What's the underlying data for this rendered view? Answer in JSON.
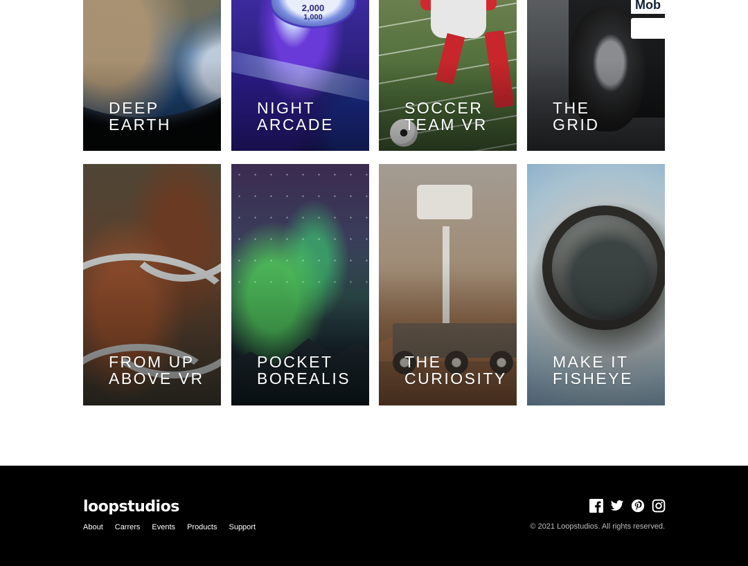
{
  "cards": [
    {
      "title_line1": "DEEP",
      "title_line2": "EARTH"
    },
    {
      "title_line1": "NIGHT",
      "title_line2": "ARCADE"
    },
    {
      "title_line1": "SOCCER",
      "title_line2": "TEAM VR"
    },
    {
      "title_line1": "THE",
      "title_line2": "GRID"
    },
    {
      "title_line1": "FROM UP",
      "title_line2": "ABOVE VR"
    },
    {
      "title_line1": "POCKET",
      "title_line2": "BOREALIS"
    },
    {
      "title_line1": "THE",
      "title_line2": "CURIOSITY"
    },
    {
      "title_line1": "MAKE IT",
      "title_line2": "FISHEYE"
    }
  ],
  "footer": {
    "logo": "loopstudios",
    "nav": [
      "About",
      "Carrers",
      "Events",
      "Products",
      "Support"
    ],
    "social": [
      "facebook-icon",
      "twitter-icon",
      "pinterest-icon",
      "instagram-icon"
    ],
    "copyright": "© 2021 Loopstudios. All rights reserved."
  },
  "colors": {
    "footer_bg": "#000000",
    "page_bg": "#ffffff",
    "title_text": "#ffffff"
  },
  "arcade_disc_labels": [
    "2,000",
    "1,000"
  ],
  "grid_car_brand": "Mob"
}
